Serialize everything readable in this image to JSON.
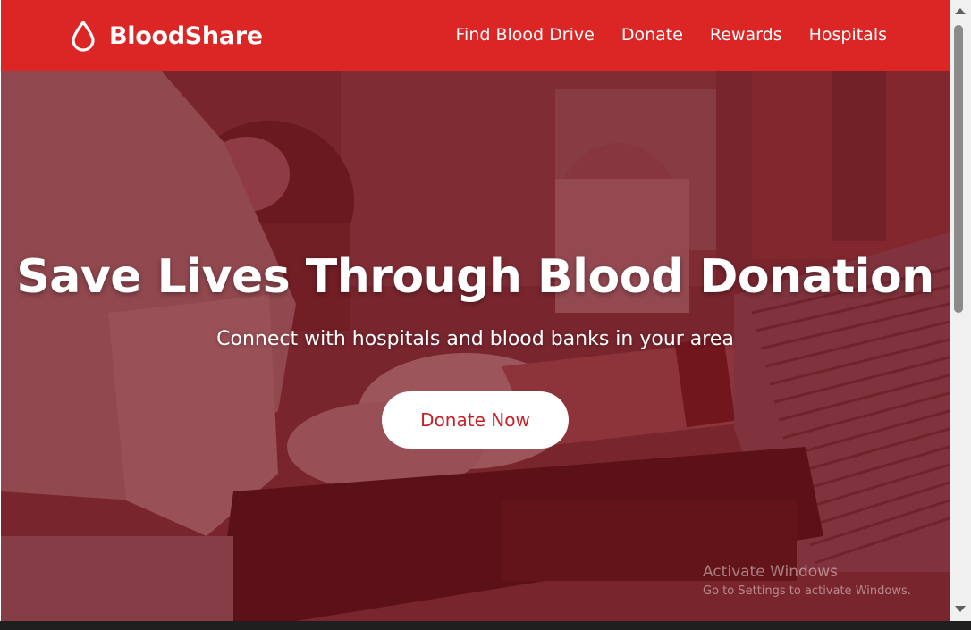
{
  "brand": {
    "name": "BloodShare",
    "logo_icon": "blood-drop-icon"
  },
  "nav": {
    "items": [
      {
        "label": "Find Blood Drive"
      },
      {
        "label": "Donate"
      },
      {
        "label": "Rewards"
      },
      {
        "label": "Hospitals"
      }
    ]
  },
  "hero": {
    "title": "Save Lives Through Blood Donation",
    "subtitle": "Connect with hospitals and blood banks in your area",
    "cta_label": "Donate Now",
    "background": "photo-of-blood-donation-with-red-overlay"
  },
  "watermark": {
    "title": "Activate Windows",
    "subtitle": "Go to Settings to activate Windows."
  },
  "colors": {
    "brand_red": "#dc2626",
    "cta_text": "#c81e28",
    "overlay": "rgba(120,20,30,0.55)"
  }
}
